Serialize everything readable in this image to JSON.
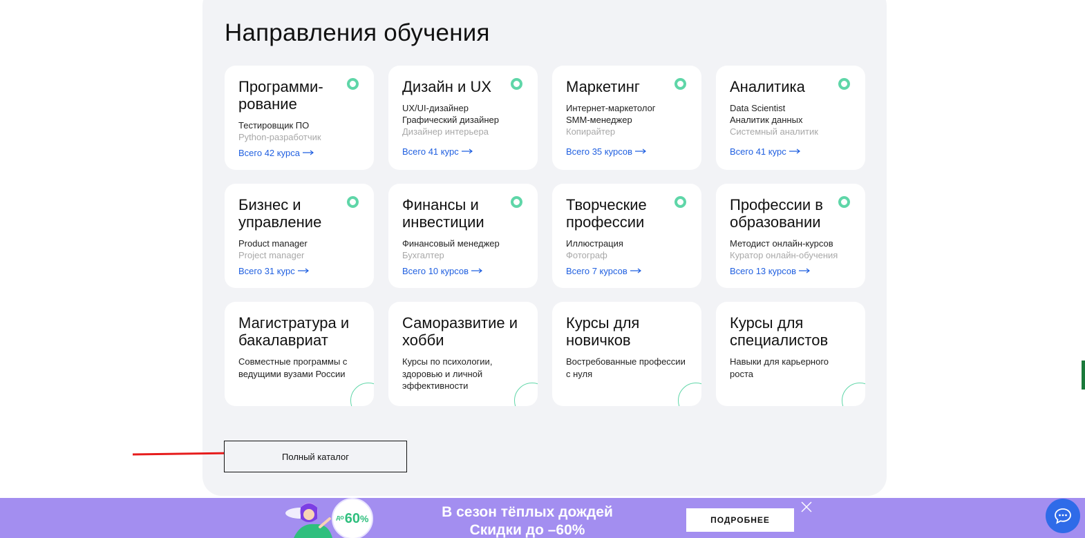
{
  "section": {
    "title": "Направления обучения"
  },
  "cards": [
    {
      "title": "Програм­ми­рование",
      "subs": [
        "Тестировщик ПО",
        "Python-разработчик"
      ],
      "link": "Всего 42 курса"
    },
    {
      "title": "Дизайн и UX",
      "subs": [
        "UX/UI-дизайнер",
        "Графический дизайнер",
        "Дизайнер интерьера"
      ],
      "link": "Всего 41 курс"
    },
    {
      "title": "Маркетинг",
      "subs": [
        "Интернет-маркетолог",
        "SMM-менеджер",
        "Копирайтер"
      ],
      "link": "Всего 35 курсов"
    },
    {
      "title": "Аналитика",
      "subs": [
        "Data Scientist",
        "Аналитик данных",
        "Системный аналитик"
      ],
      "link": "Всего 41 курс"
    },
    {
      "title": "Бизнес и управление",
      "subs": [
        "Product manager",
        "Project manager"
      ],
      "link": "Всего 31 курс"
    },
    {
      "title": "Финансы и инвестиции",
      "subs": [
        "Финансовый менеджер",
        "Бухгалтер"
      ],
      "link": "Всего 10 курсов"
    },
    {
      "title": "Творческие профессии",
      "subs": [
        "Иллюстрация",
        "Фотограф"
      ],
      "link": "Всего 7 курсов"
    },
    {
      "title": "Профессии в образовании",
      "subs": [
        "Методист онлайн-курсов",
        "Куратор онлайн-обучения"
      ],
      "link": "Всего 13 курсов"
    },
    {
      "title": "Магистратура и бакалавриат",
      "desc": "Совместные программы с ведущими вузами России"
    },
    {
      "title": "Саморазвитие и хобби",
      "desc": "Курсы по психологии, здоровью и личной эффективности"
    },
    {
      "title": "Курсы для новичков",
      "desc": "Востребованные профессии с нуля"
    },
    {
      "title": "Курсы для специалистов",
      "desc": "Навыки для карьерного роста"
    }
  ],
  "catalog_button": "Полный каталог",
  "banner": {
    "line1": "В сезон тёплых дождей",
    "line2": "Скидки до –60%",
    "button": "ПОДРОБНЕЕ",
    "badge_prefix": "до",
    "badge_value": "60",
    "badge_pct": "%"
  },
  "colors": {
    "accent_green": "#5fd6a8",
    "link_blue": "#1f5fe0",
    "banner_purple": "#a38ef0",
    "chat_blue": "#2f6be8"
  }
}
